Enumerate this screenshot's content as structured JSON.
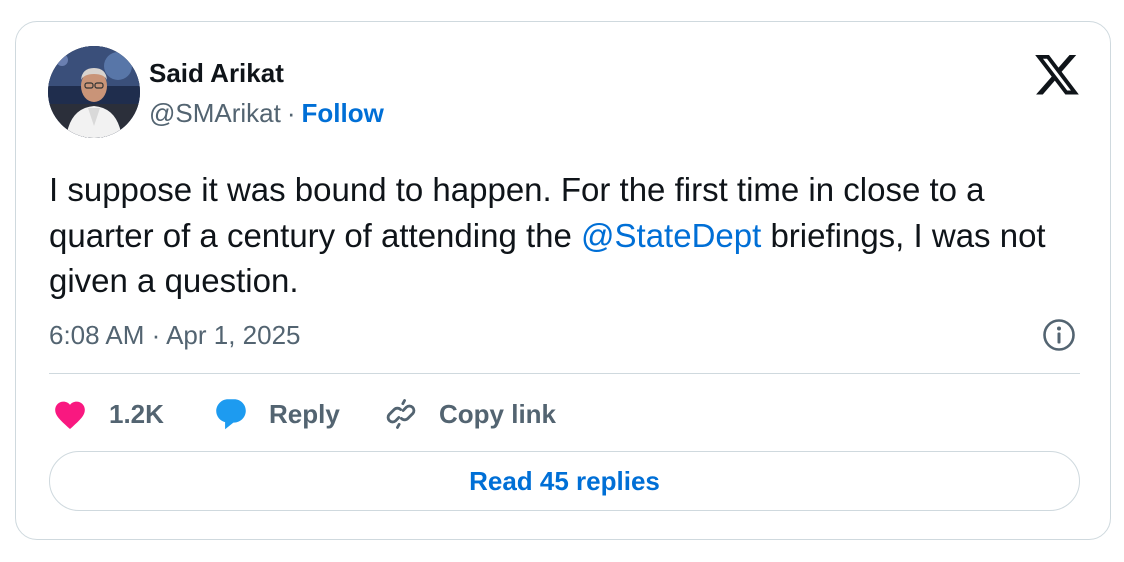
{
  "author": {
    "name": "Said Arikat",
    "handle": "@SMArikat",
    "separator": "·",
    "follow_label": "Follow"
  },
  "tweet": {
    "text_before": "I suppose it was bound to happen. For the first time in close to a quarter of a century of attending the ",
    "mention": "@StateDept",
    "text_after": " briefings, I was not given a question.",
    "timestamp": "6:08 AM · Apr 1, 2025"
  },
  "actions": {
    "like_count": "1.2K",
    "reply_label": "Reply",
    "copy_link_label": "Copy link"
  },
  "read_replies_label": "Read 45 replies",
  "icons": {
    "brand": "x-logo-icon",
    "info": "info-icon",
    "like": "heart-icon",
    "reply": "speech-bubble-icon",
    "copy": "link-icon"
  },
  "colors": {
    "link_blue": "#006fd6",
    "muted_text": "#536471",
    "like_pink": "#f91880",
    "reply_blue": "#1d9bf0",
    "border": "#cfd9de"
  }
}
